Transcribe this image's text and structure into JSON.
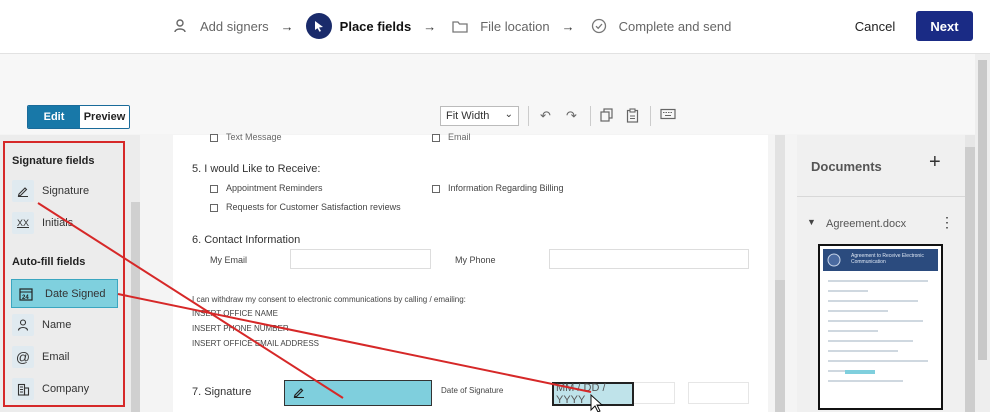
{
  "wizard": {
    "steps": [
      {
        "label": "Add signers"
      },
      {
        "label": "Place fields"
      },
      {
        "label": "File location"
      },
      {
        "label": "Complete and send"
      }
    ],
    "cancel_label": "Cancel",
    "next_label": "Next",
    "accent_color": "#1a2b85"
  },
  "toolbar": {
    "edit_label": "Edit",
    "preview_label": "Preview",
    "zoom_value": "Fit Width"
  },
  "fields_panel": {
    "signature_section": "Signature fields",
    "signature_items": [
      {
        "label": "Signature",
        "icon": "pen-icon"
      },
      {
        "label": "Initials",
        "icon": "initials-icon",
        "glyph": "XX"
      }
    ],
    "autofill_section": "Auto-fill fields",
    "autofill_items": [
      {
        "label": "Date Signed",
        "icon": "calendar-icon",
        "glyph": "24"
      },
      {
        "label": "Name",
        "icon": "person-icon"
      },
      {
        "label": "Email",
        "icon": "at-icon"
      },
      {
        "label": "Company",
        "icon": "building-icon"
      }
    ]
  },
  "document": {
    "top_partial_left": "Text Message",
    "top_partial_right": "Email",
    "q5": "5.   I would Like to Receive:",
    "q5_options": [
      "Appointment Reminders",
      "Information Regarding Billing",
      "Requests for Customer Satisfaction reviews"
    ],
    "q6": "6.   Contact Information",
    "email_label": "My Email",
    "phone_label": "My Phone",
    "withdraw_text": "I can withdraw my consent to electronic communications by calling / emailing:",
    "office_lines": [
      "INSERT OFFICE NAME",
      "INSERT PHONE NUMBER",
      "INSERT OFFICE EMAIL ADDRESS"
    ],
    "q7": "7. Signature",
    "date_of_signature_label": "Date of Signature",
    "date_placeholder": "MM / DD / YYYY"
  },
  "documents_panel": {
    "title": "Documents",
    "file_name": "Agreement.docx",
    "thumb_header": "Agreement to Receive Electronic Communication"
  }
}
